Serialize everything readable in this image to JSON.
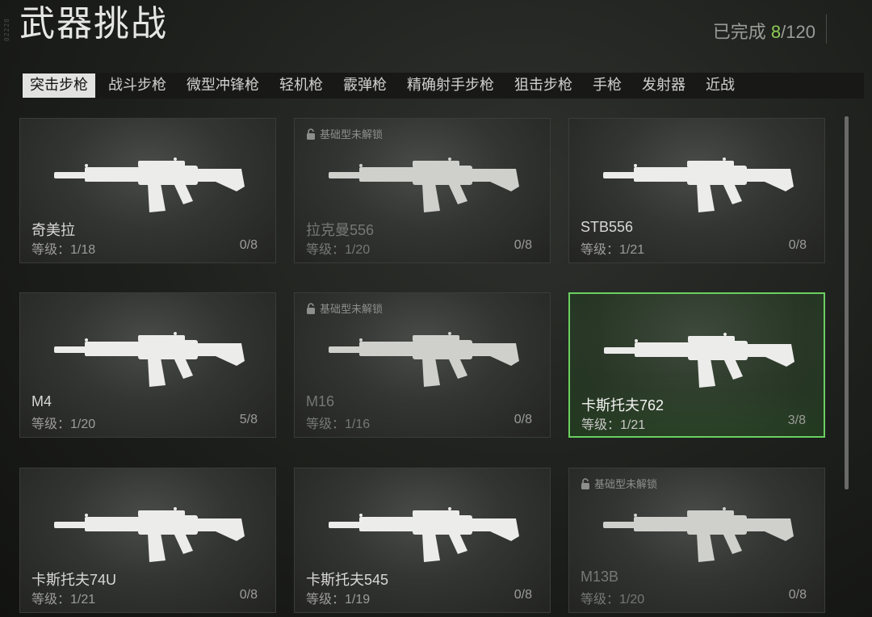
{
  "header": {
    "side_code": "02228",
    "title": "武器挑战",
    "progress_prefix": "已完成 ",
    "progress_done": "8",
    "progress_suffix": "/120",
    "accent": "#8dcc55"
  },
  "tabs": [
    {
      "label": "突击步枪",
      "active": true
    },
    {
      "label": "战斗步枪"
    },
    {
      "label": "微型冲锋枪"
    },
    {
      "label": "轻机枪"
    },
    {
      "label": "霰弹枪"
    },
    {
      "label": "精确射手步枪"
    },
    {
      "label": "狙击步枪"
    },
    {
      "label": "手枪"
    },
    {
      "label": "发射器"
    },
    {
      "label": "近战"
    }
  ],
  "lock_text": "基础型未解锁",
  "weapons": [
    {
      "name": "奇美拉",
      "level": "等级：1/18",
      "count": "0/8",
      "locked": false,
      "selected": false,
      "icon": "rifle-icon"
    },
    {
      "name": "拉克曼556",
      "level": "等级：1/20",
      "count": "0/8",
      "locked": true,
      "selected": false,
      "icon": "rifle-icon"
    },
    {
      "name": "STB556",
      "level": "等级：1/21",
      "count": "0/8",
      "locked": false,
      "selected": false,
      "icon": "rifle-icon"
    },
    {
      "name": "M4",
      "level": "等级：1/20",
      "count": "5/8",
      "locked": false,
      "selected": false,
      "icon": "rifle-icon"
    },
    {
      "name": "M16",
      "level": "等级：1/16",
      "count": "0/8",
      "locked": true,
      "selected": false,
      "icon": "rifle-icon"
    },
    {
      "name": "卡斯托夫762",
      "level": "等级：1/21",
      "count": "3/8",
      "locked": false,
      "selected": true,
      "icon": "rifle-icon"
    },
    {
      "name": "卡斯托夫74U",
      "level": "等级：1/21",
      "count": "0/8",
      "locked": false,
      "selected": false,
      "icon": "rifle-icon"
    },
    {
      "name": "卡斯托夫545",
      "level": "等级：1/19",
      "count": "0/8",
      "locked": false,
      "selected": false,
      "icon": "rifle-icon"
    },
    {
      "name": "M13B",
      "level": "等级：1/20",
      "count": "0/8",
      "locked": true,
      "selected": false,
      "icon": "rifle-icon"
    }
  ]
}
